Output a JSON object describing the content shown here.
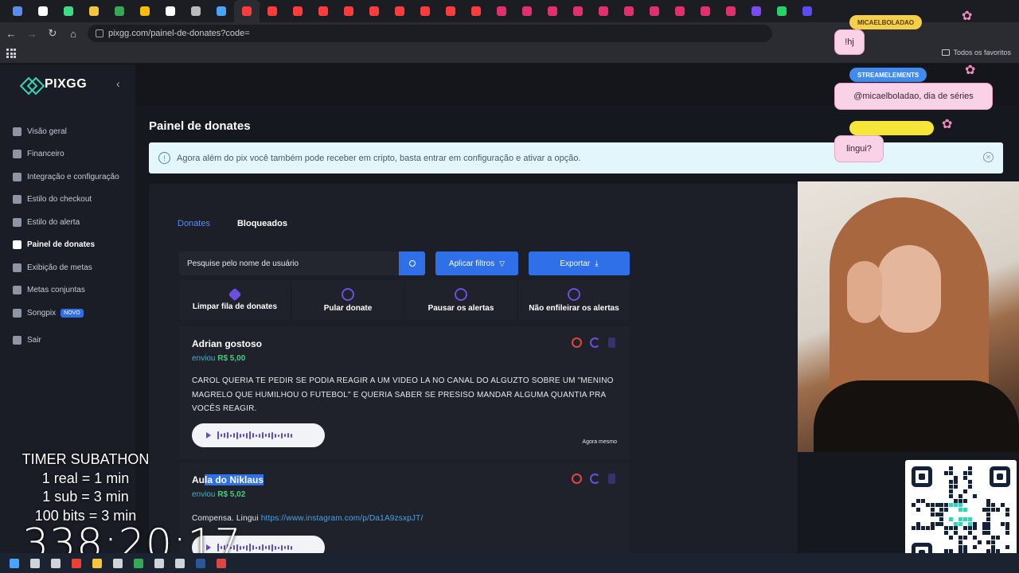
{
  "browser": {
    "url": "pixgg.com/painel-de-donates?code=",
    "favorites_label": "Todos os favoritos"
  },
  "sidebar": {
    "logo": "PIXGG",
    "items": [
      {
        "label": "Visão geral",
        "icon": "home-icon"
      },
      {
        "label": "Financeiro",
        "icon": "wallet-icon"
      },
      {
        "label": "Integração e configuração",
        "icon": "gear-icon"
      },
      {
        "label": "Estilo do checkout",
        "icon": "palette-icon"
      },
      {
        "label": "Estilo do alerta",
        "icon": "palette-icon"
      },
      {
        "label": "Painel de donates",
        "icon": "bars-icon"
      },
      {
        "label": "Exibição de metas",
        "icon": "star-icon"
      },
      {
        "label": "Metas conjuntas",
        "icon": "people-icon"
      },
      {
        "label": "Songpix",
        "icon": "music-icon",
        "badge": "NOVO"
      },
      {
        "label": "Sair",
        "icon": "logout-icon"
      }
    ],
    "active_index": 5
  },
  "page": {
    "title": "Painel de donates",
    "notice": "Agora além do pix você também pode receber em cripto, basta entrar em configuração e ativar a opção."
  },
  "tabs": [
    "Donates",
    "Bloqueados"
  ],
  "filters": {
    "search_placeholder": "Pesquise pelo nome de usuário",
    "apply_label": "Aplicar filtros",
    "export_label": "Exportar"
  },
  "actions": [
    {
      "label": "Limpar fila de donates",
      "icon": "eraser-icon"
    },
    {
      "label": "Pular donate",
      "icon": "skip-icon"
    },
    {
      "label": "Pausar os alertas",
      "icon": "pause-icon"
    },
    {
      "label": "Não enfileirar os alertas",
      "icon": "bell-off-icon"
    }
  ],
  "donations": [
    {
      "name": "Adrian gostoso",
      "sent_label": "enviou",
      "amount": "R$ 5,00",
      "message": "CAROL QUERIA TE PEDIR SE PODIA REAGIR A UM VIDEO LA NO CANAL DO ALGUZTO SOBRE UM \"MENINO MAGRELO QUE HUMILHOU O FUTEBOL\" E QUERIA SABER SE PRESISO MANDAR ALGUMA QUANTIA PRA VOCÊS REAGIR.",
      "time": "Agora mesmo"
    },
    {
      "name_plain": "Au",
      "name_highlight": "la do Niklaus",
      "sent_label": "enviou",
      "amount": "R$ 5,02",
      "message": "Compensa. Lingui ",
      "link": "https://www.instagram.com/p/Da1A9zsxpJT/"
    }
  ],
  "stream_overlay": {
    "chat": [
      {
        "user": "MICAELBOLADAO",
        "text": "!hj"
      },
      {
        "user": "STREAMELEMENTS",
        "text": "@micaelboladao, dia de séries"
      },
      {
        "user": "",
        "text": "lingui?"
      }
    ],
    "timer_title": "TIMER SUBATHON",
    "timer_rules": [
      "1 real = 1 min",
      "1 sub = 3 min",
      "100 bits = 3 min"
    ],
    "timer_value": "338:20:17"
  },
  "colors": {
    "accent": "#2f6fe8",
    "amount_green": "#3fd07e",
    "ban_red": "#e04545",
    "purple": "#6c4ee0"
  }
}
